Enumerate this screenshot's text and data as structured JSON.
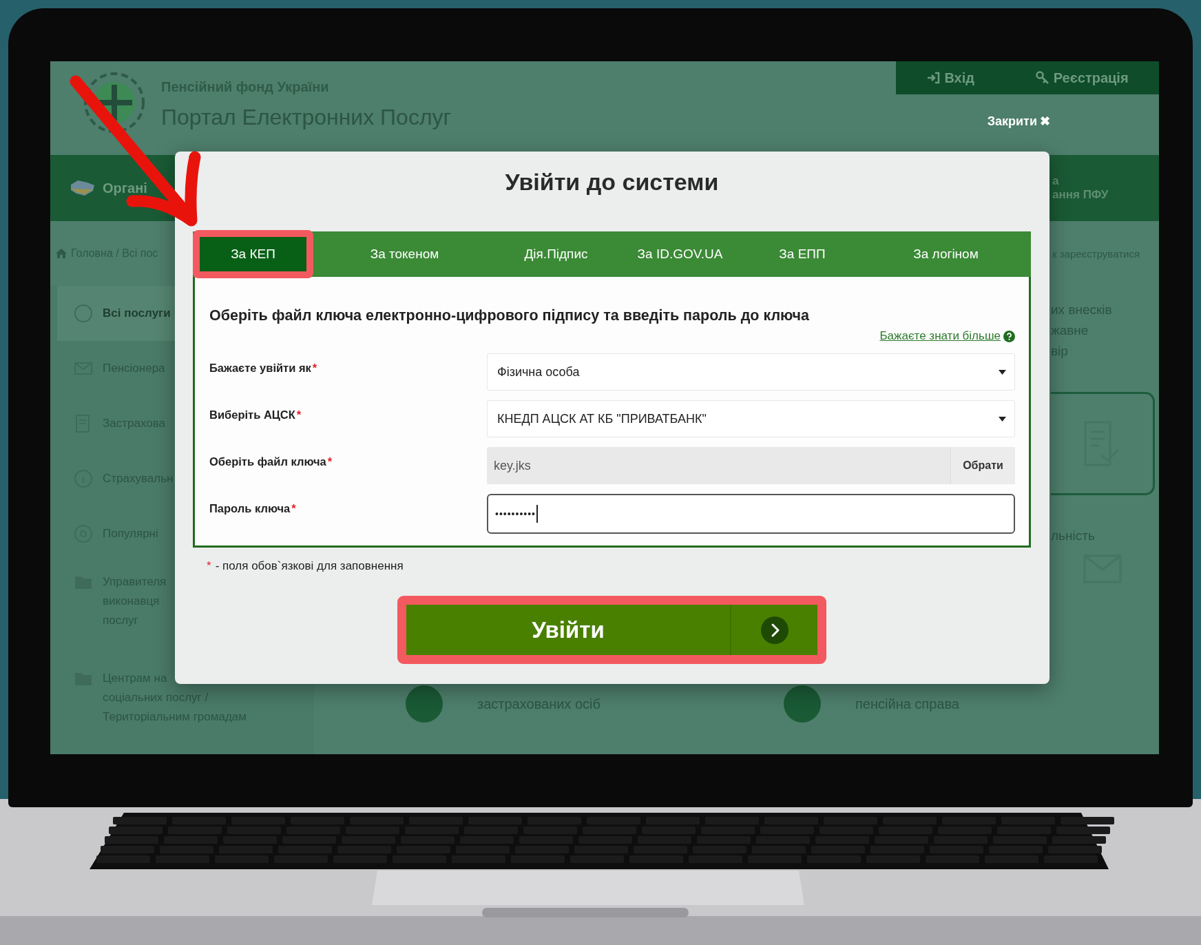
{
  "header": {
    "org": "Пенсійний фонд України",
    "title": "Портал Електронних Послуг",
    "top_links": [
      "Вхід",
      "Реєстрація"
    ],
    "close": {
      "label": "Закрити",
      "icon": "✖"
    }
  },
  "nav": {
    "left": "Органі",
    "right": [
      "а",
      "ання ПФУ"
    ]
  },
  "breadcrumb": {
    "path": "Головна / Всі пос",
    "right": "к зареєструватися"
  },
  "sidebar": {
    "items": [
      {
        "lines": [
          "Всі послуги"
        ],
        "selected": true
      },
      {
        "lines": [
          "Пенсіонера"
        ],
        "selected": false
      },
      {
        "lines": [
          "Застрахова"
        ],
        "selected": false
      },
      {
        "lines": [
          "Страхувальн"
        ],
        "selected": false
      },
      {
        "lines": [
          "Популярні"
        ],
        "selected": false
      },
      {
        "lines": [
          "Управителя",
          "виконавця",
          "послуг"
        ],
        "selected": false
      },
      {
        "lines": [
          "Центрам на",
          "соціальних послуг /",
          "Територіальним громадам"
        ],
        "selected": false
      }
    ]
  },
  "right_column": {
    "top": [
      "их внесків",
      "жавне",
      "вір"
    ],
    "lower": "льність"
  },
  "bottom": {
    "items": [
      "застрахованих осіб",
      "пенсійна справа"
    ]
  },
  "modal": {
    "title": "Увійти до системи",
    "tabs": [
      {
        "label": "За КЕП",
        "selected": true,
        "highlighted": true
      },
      {
        "label": "За токеном",
        "selected": false,
        "highlighted": false
      },
      {
        "label": "Дія.Підпис",
        "selected": false,
        "highlighted": false
      },
      {
        "label": "За ID.GOV.UA",
        "selected": false,
        "highlighted": false
      },
      {
        "label": "За ЕПП",
        "selected": false,
        "highlighted": false
      },
      {
        "label": "За логіном",
        "selected": false,
        "highlighted": false
      }
    ],
    "instruction": "Оберіть файл ключа електронно-цифрового підпису та введіть пароль до ключа",
    "help_link": "Бажаєте знати більше",
    "fields": [
      {
        "kind": "select",
        "label": "Бажаєте увійти як",
        "mark": "*",
        "value": "Фізична особа"
      },
      {
        "kind": "select",
        "label": "Виберіть АЦСК",
        "mark": "*",
        "value": "КНЕДП АЦСК АТ КБ \"ПРИВАТБАНК\""
      },
      {
        "kind": "file",
        "label": "Оберіть файл ключа",
        "mark": "*",
        "value": "key.jks",
        "button": "Обрати"
      },
      {
        "kind": "password",
        "label": "Пароль ключа",
        "mark": "*",
        "value": "••••••••••",
        "focused": true
      }
    ],
    "required_note": {
      "mark": "*",
      "text": "- поля обов`язкові для заповнення"
    },
    "submit": {
      "label": "Увійти",
      "highlighted": true
    }
  }
}
